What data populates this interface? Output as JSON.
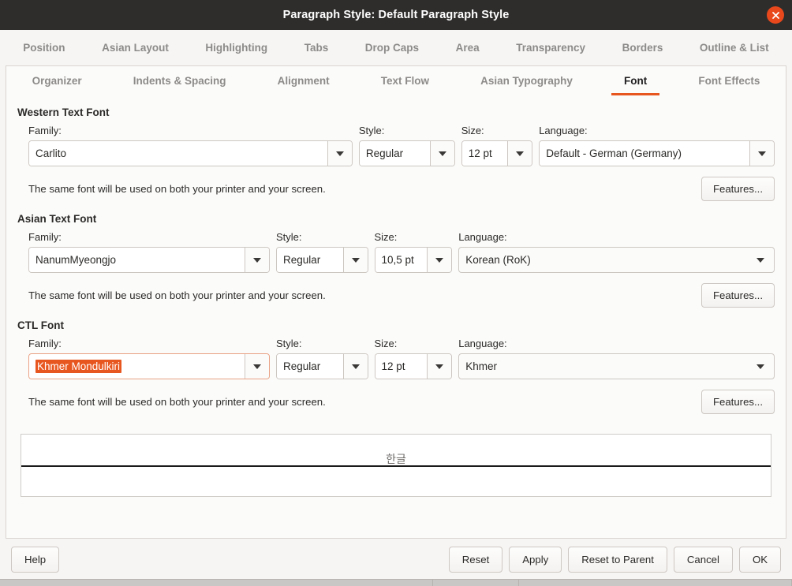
{
  "window": {
    "title": "Paragraph Style: Default Paragraph Style",
    "close_icon": "close-icon"
  },
  "tabs_row1": [
    {
      "label": "Position"
    },
    {
      "label": "Asian Layout"
    },
    {
      "label": "Highlighting"
    },
    {
      "label": "Tabs"
    },
    {
      "label": "Drop Caps"
    },
    {
      "label": "Area"
    },
    {
      "label": "Transparency"
    },
    {
      "label": "Borders"
    },
    {
      "label": "Outline & List"
    }
  ],
  "tabs_row2": [
    {
      "label": "Organizer",
      "active": false
    },
    {
      "label": "Indents & Spacing",
      "active": false
    },
    {
      "label": "Alignment",
      "active": false
    },
    {
      "label": "Text Flow",
      "active": false
    },
    {
      "label": "Asian Typography",
      "active": false
    },
    {
      "label": "Font",
      "active": true
    },
    {
      "label": "Font Effects",
      "active": false
    }
  ],
  "labels": {
    "family": "Family:",
    "style": "Style:",
    "size": "Size:",
    "language": "Language:",
    "note": "The same font will be used on both your printer and your screen.",
    "features": "Features..."
  },
  "western": {
    "title": "Western Text Font",
    "family": "Carlito",
    "style": "Regular",
    "size": "12 pt",
    "language": "Default - German (Germany)"
  },
  "asian": {
    "title": "Asian Text Font",
    "family": "NanumMyeongjo",
    "style": "Regular",
    "size": "10,5 pt",
    "language": "Korean (RoK)"
  },
  "ctl": {
    "title": "CTL Font",
    "family": "Khmer Mondulkiri",
    "style": "Regular",
    "size": "12 pt",
    "language": "Khmer"
  },
  "preview": {
    "text": "한글"
  },
  "actions": {
    "help": "Help",
    "reset": "Reset",
    "apply": "Apply",
    "reset_to_parent": "Reset to Parent",
    "cancel": "Cancel",
    "ok": "OK"
  },
  "colors": {
    "accent": "#e8561f",
    "titlebar": "#2f2d2c",
    "selection": "#e8561f"
  }
}
